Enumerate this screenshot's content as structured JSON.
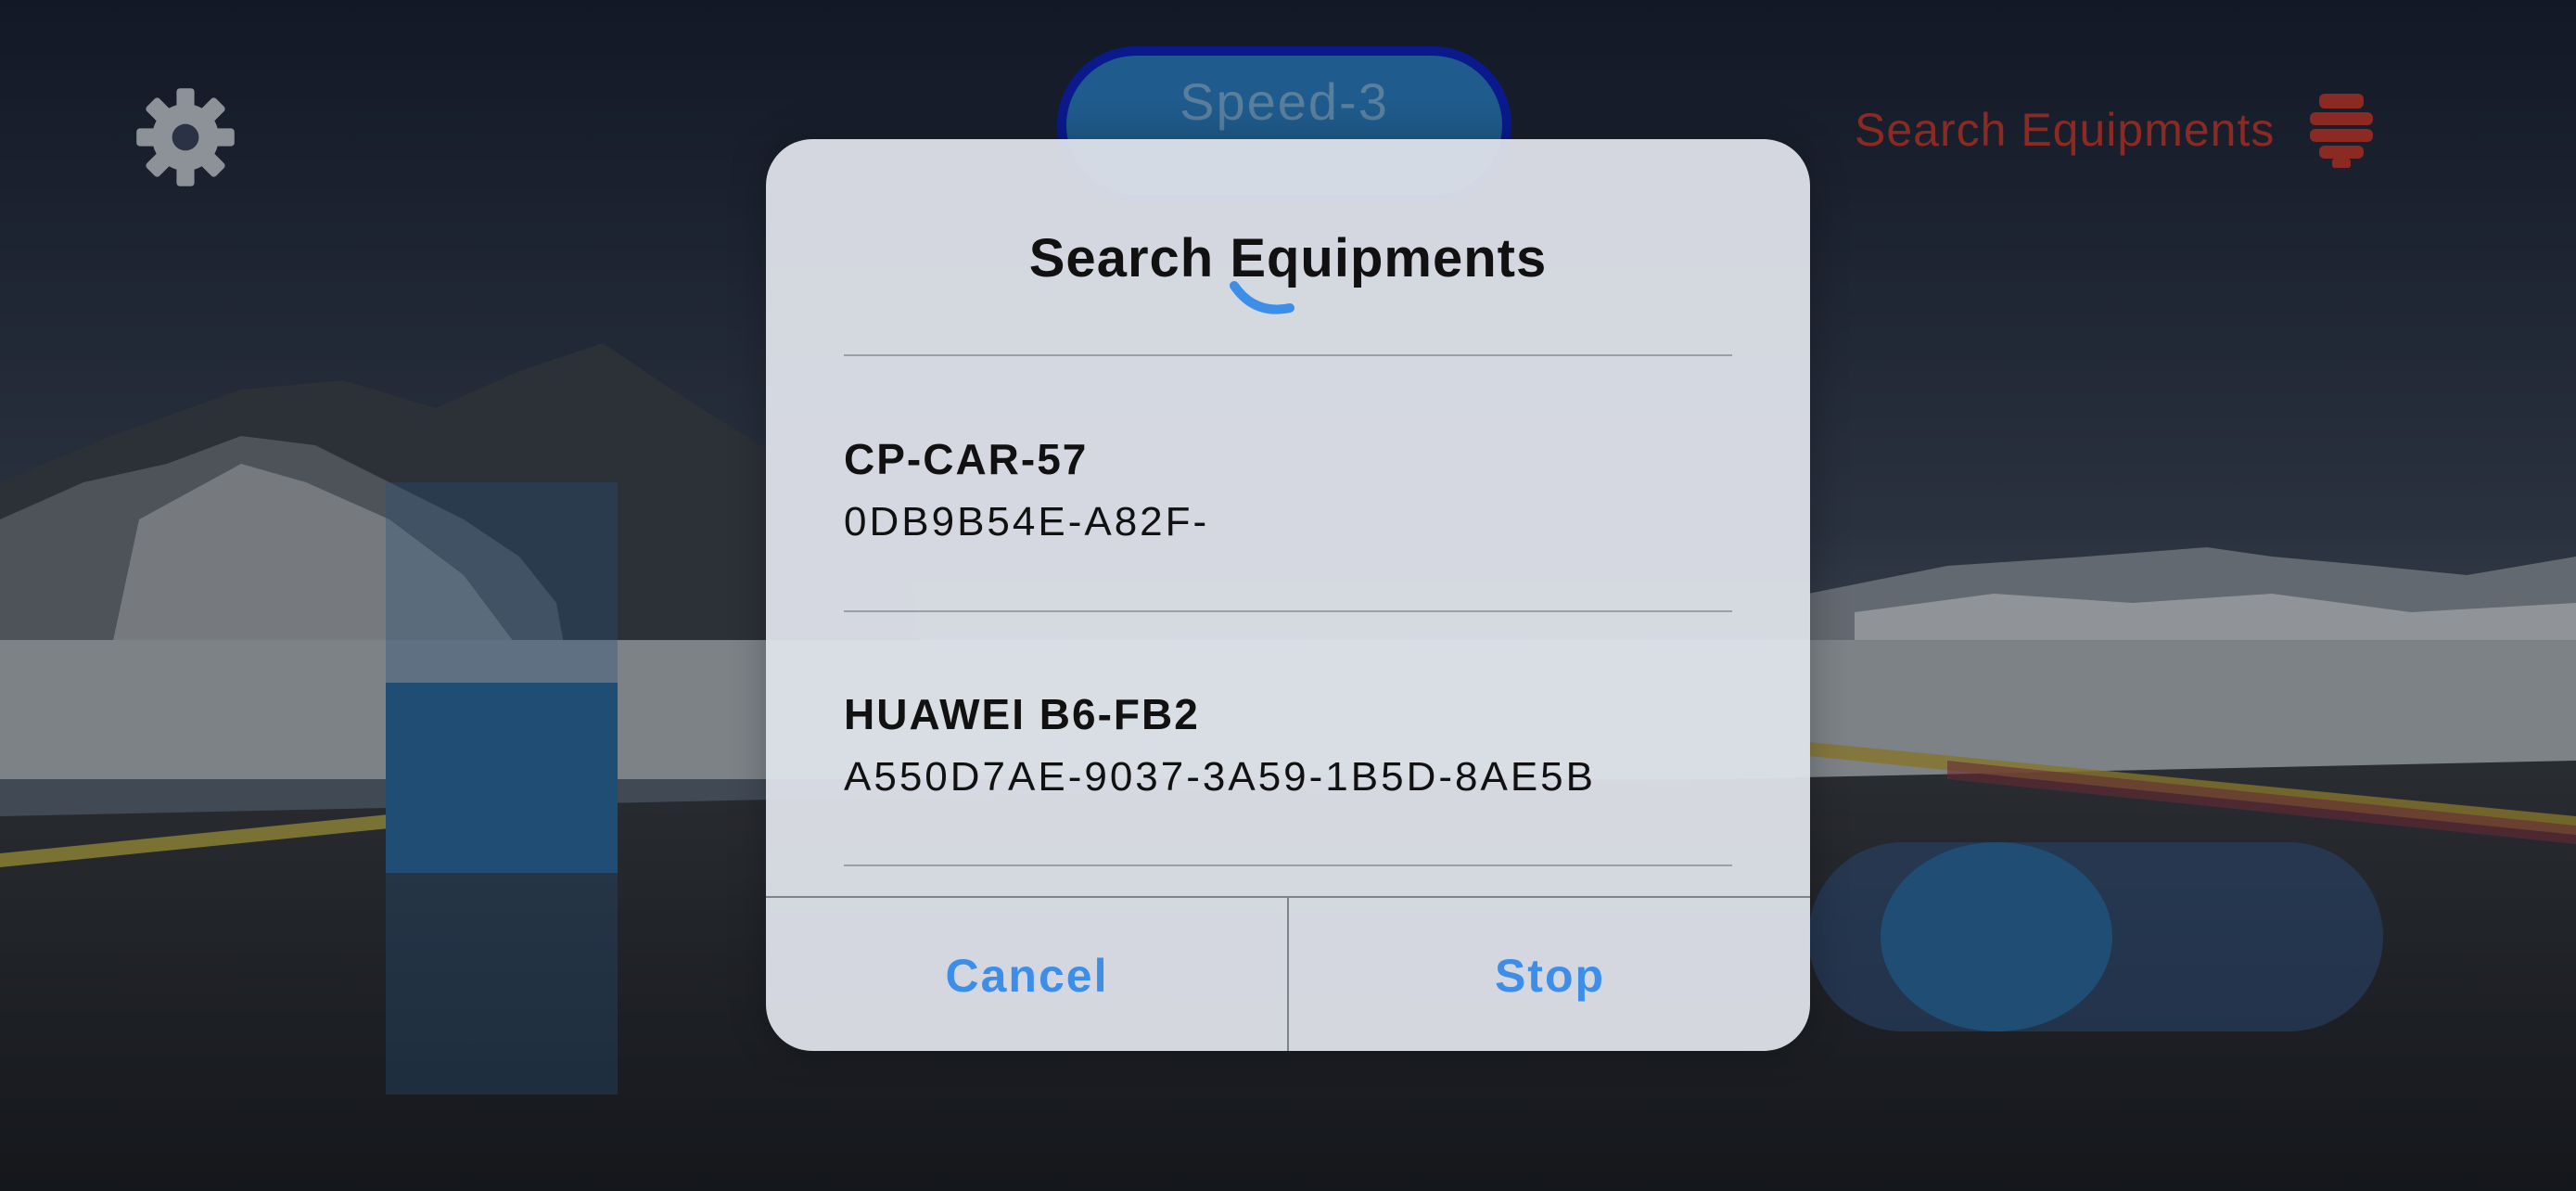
{
  "hud": {
    "speed_label": "Speed-3",
    "search_label": "Search Equipments",
    "gear_icon": "gear-icon",
    "search_icon": "device-icon"
  },
  "controls": {
    "throttle_level": 0.17,
    "steer_position": "left"
  },
  "dialog": {
    "title": "Search Equipments",
    "loading": true,
    "devices": [
      {
        "name": "CP-CAR-57",
        "id": "0DB9B54E-A82F-"
      },
      {
        "name": "HUAWEI B6-FB2",
        "id": "A550D7AE-9037-3A59-1B5D-8AE5B"
      }
    ],
    "cancel_label": "Cancel",
    "stop_label": "Stop"
  },
  "colors": {
    "accent": "#3c8ee8",
    "hud_red": "#8a2a22",
    "control_blue": "#1f4d73"
  }
}
